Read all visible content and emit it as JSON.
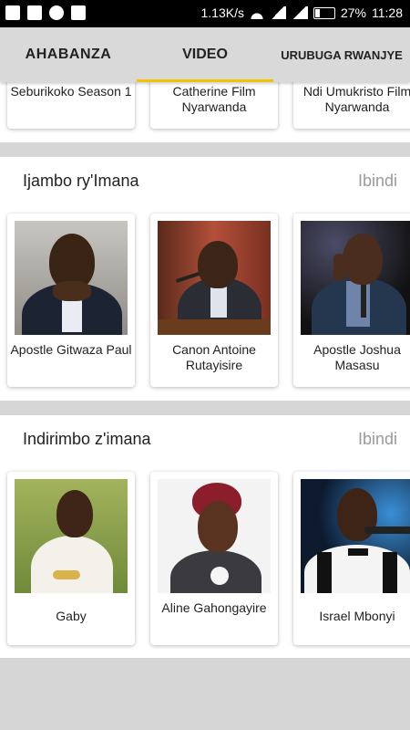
{
  "status_bar": {
    "speed": "1.13K/s",
    "battery": "27%",
    "time": "11:28"
  },
  "tabs": [
    {
      "label": "AHABANZA",
      "active": false
    },
    {
      "label": "VIDEO",
      "active": true
    },
    {
      "label": "URUBUGA RWANJYE",
      "active": false
    }
  ],
  "accent_color": "#f2c400",
  "top_row": {
    "cards": [
      {
        "title": "Seburikoko Season 1"
      },
      {
        "title": "Catherine  Film Nyarwanda"
      },
      {
        "title": "Ndi Umukristo Film Nyarwanda"
      }
    ]
  },
  "sections": [
    {
      "title": "Ijambo ry'Imana",
      "more": "Ibindi",
      "cards": [
        {
          "title": "Apostle Gitwaza Paul",
          "image": "portrait-man-suit"
        },
        {
          "title": "Canon Antoine Rutayisire",
          "image": "portrait-man-podium"
        },
        {
          "title": "Apostle Joshua Masasu",
          "image": "portrait-man-microphone"
        }
      ]
    },
    {
      "title": "Indirimbo z'imana",
      "more": "Ibindi",
      "cards": [
        {
          "title": "Gaby",
          "image": "portrait-woman-white-dress"
        },
        {
          "title": "Aline Gahongayire",
          "image": "portrait-woman-red-hair"
        },
        {
          "title": "Israel Mbonyi",
          "image": "portrait-man-bowtie"
        }
      ]
    }
  ]
}
